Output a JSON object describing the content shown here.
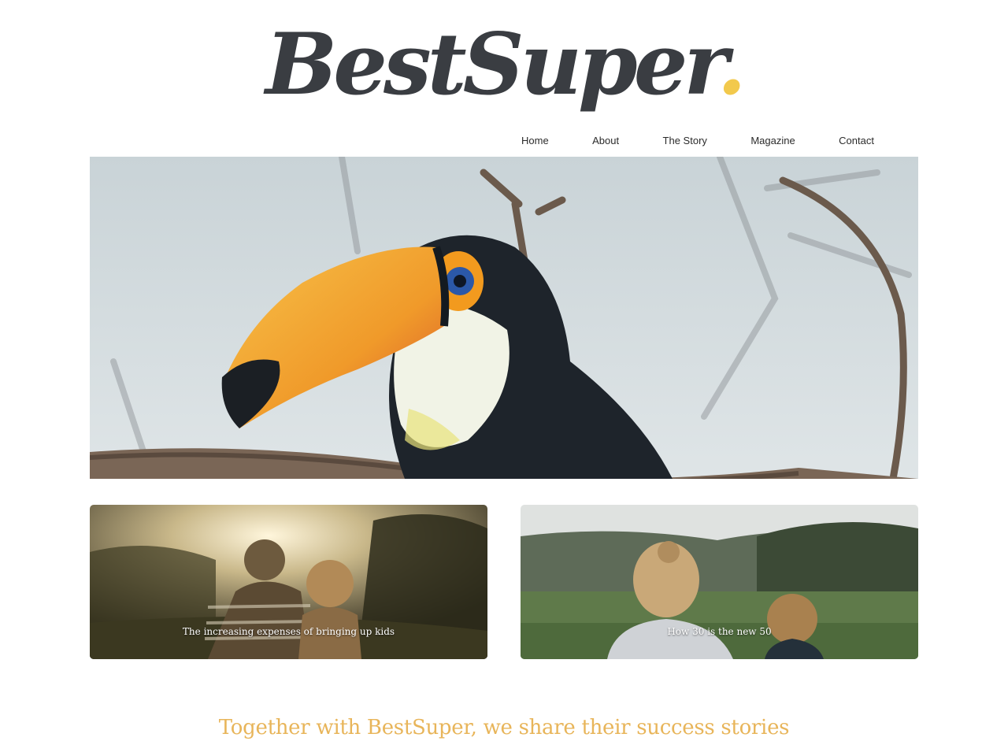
{
  "header": {
    "logo_text": "BestSuper",
    "logo_dot": "."
  },
  "nav": {
    "items": [
      {
        "label": "Home"
      },
      {
        "label": "About"
      },
      {
        "label": "The Story"
      },
      {
        "label": "Magazine"
      },
      {
        "label": "Contact"
      }
    ]
  },
  "hero": {
    "image": "toucan-photo"
  },
  "cards": [
    {
      "title": "The increasing expenses of bringing up kids",
      "image": "children-sunset-photo"
    },
    {
      "title": "How 30 is the new 50",
      "image": "family-outdoors-photo"
    }
  ],
  "tagline": "Together with BestSuper, we share their success stories",
  "colors": {
    "accent_dot": "#f2c94c",
    "tagline": "#e8b55a",
    "logo": "#3a3d42"
  }
}
